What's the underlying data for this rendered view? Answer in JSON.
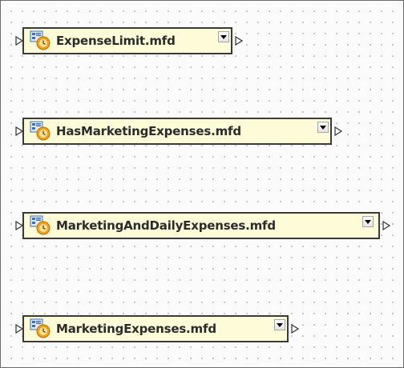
{
  "canvas": {
    "nodes": [
      {
        "label": "ExpenseLimit.mfd",
        "icon": "mapping-function-icon"
      },
      {
        "label": "HasMarketingExpenses.mfd",
        "icon": "mapping-function-icon"
      },
      {
        "label": "MarketingAndDailyExpenses.mfd",
        "icon": "mapping-function-icon"
      },
      {
        "label": "MarketingExpenses.mfd",
        "icon": "mapping-function-icon"
      }
    ]
  },
  "colors": {
    "node_fill": "#fdfbd8",
    "node_border": "#3a3a3a",
    "icon_orange": "#f2a21b",
    "icon_blue": "#3b6fb6"
  }
}
